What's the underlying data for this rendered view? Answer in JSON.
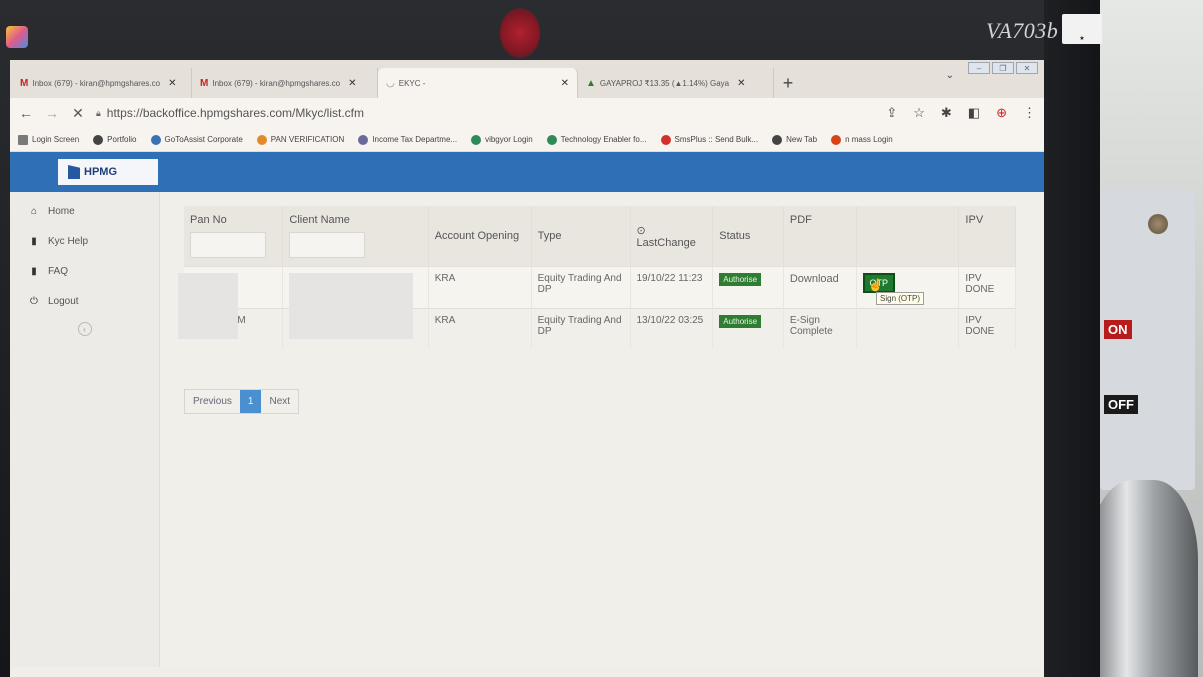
{
  "monitor": {
    "brand": "VA703b"
  },
  "browser": {
    "tabs": [
      {
        "label": "Inbox (679) - kiran@hpmgshares.co",
        "icon": "gmail-icon"
      },
      {
        "label": "Inbox (679) - kiran@hpmgshares.co",
        "icon": "gmail-icon"
      },
      {
        "label": "EKYC -",
        "icon": "loading-icon",
        "active": true
      },
      {
        "label": "GAYAPROJ ₹13.35 (▲1.14%) Gaya",
        "icon": "stock-icon"
      }
    ],
    "url": "https://backoffice.hpmgshares.com/Mkyc/list.cfm",
    "bookmarks": [
      "Login Screen",
      "Portfolio",
      "GoToAssist Corporate",
      "PAN VERIFICATION",
      "Income Tax Departme...",
      "vibgyor Login",
      "Technology Enabler fo...",
      "SmsPlus :: Send Bulk...",
      "New Tab",
      "n mass Login"
    ]
  },
  "app": {
    "logo": "HPMG",
    "sidebar": [
      {
        "label": "Home",
        "icon": "home-icon"
      },
      {
        "label": "Kyc Help",
        "icon": "book-icon"
      },
      {
        "label": "FAQ",
        "icon": "book-icon"
      },
      {
        "label": "Logout",
        "icon": "power-icon"
      }
    ],
    "table": {
      "headers": {
        "pan": "Pan No",
        "client": "Client Name",
        "account": "Account Opening",
        "type": "Type",
        "last": "⊙ LastChange",
        "status": "Status",
        "pdf": "PDF",
        "action": "",
        "ipv": "IPV"
      },
      "rows": [
        {
          "account": "KRA",
          "type": "Equity Trading And DP",
          "last": "19/10/22 11:23",
          "status": "Authorise",
          "pdf": "Download",
          "action": "OTP",
          "ipv": "IPV DONE"
        },
        {
          "client_suffix": "M",
          "account": "KRA",
          "type": "Equity Trading And DP",
          "last": "13/10/22 03:25",
          "status": "Authorise",
          "pdf": "E-Sign Complete",
          "action": "",
          "ipv": "IPV DONE"
        }
      ]
    },
    "tooltip": "Sign (OTP)",
    "pager": {
      "prev": "Previous",
      "current": "1",
      "next": "Next"
    }
  },
  "switch": {
    "on": "ON",
    "off": "OFF"
  }
}
